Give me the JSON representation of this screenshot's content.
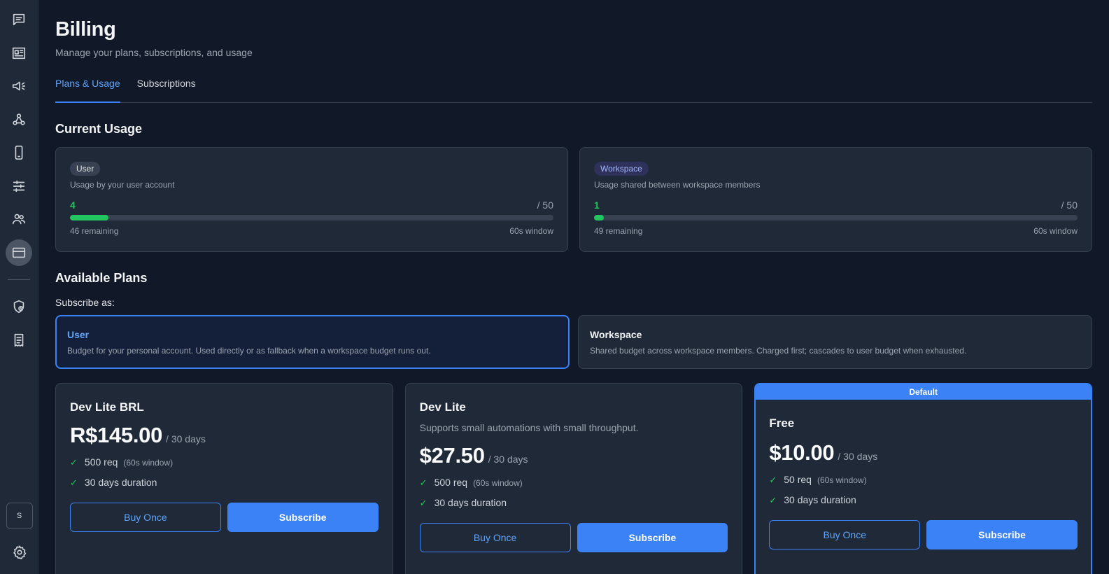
{
  "sidebar": {
    "items": [
      {
        "name": "chat-icon"
      },
      {
        "name": "dashboard-icon"
      },
      {
        "name": "megaphone-icon"
      },
      {
        "name": "webhook-icon"
      },
      {
        "name": "mobile-icon"
      },
      {
        "name": "sliders-icon"
      },
      {
        "name": "users-icon"
      },
      {
        "name": "credit-card-icon",
        "active": true
      },
      {
        "name": "shield-clock-icon"
      },
      {
        "name": "receipt-icon"
      }
    ],
    "avatar_initial": "S"
  },
  "header": {
    "title": "Billing",
    "subtitle": "Manage your plans, subscriptions, and usage"
  },
  "tabs": [
    {
      "label": "Plans & Usage",
      "active": true
    },
    {
      "label": "Subscriptions",
      "active": false
    }
  ],
  "current_usage": {
    "title": "Current Usage",
    "cards": [
      {
        "badge": "User",
        "description": "Usage by your user account",
        "used": "4",
        "limit": "/ 50",
        "fraction": 0.08,
        "remaining": "46 remaining",
        "window": "60s window"
      },
      {
        "badge": "Workspace",
        "description": "Usage shared between workspace members",
        "used": "1",
        "limit": "/ 50",
        "fraction": 0.02,
        "remaining": "49 remaining",
        "window": "60s window"
      }
    ]
  },
  "available_plans": {
    "title": "Available Plans",
    "subscribe_as_label": "Subscribe as:",
    "scopes": [
      {
        "title": "User",
        "description": "Budget for your personal account. Used directly or as fallback when a workspace budget runs out.",
        "selected": true
      },
      {
        "title": "Workspace",
        "description": "Shared budget across workspace members. Charged first; cascades to user budget when exhausted.",
        "selected": false
      }
    ],
    "plans": [
      {
        "name": "Dev Lite BRL",
        "description": "",
        "price": "R$145.00",
        "period": "/ 30 days",
        "features": [
          {
            "check": "✓",
            "text": "500 req",
            "note": "(60s window)"
          },
          {
            "check": "✓",
            "text": "30 days duration",
            "note": ""
          }
        ],
        "buy_label": "Buy Once",
        "subscribe_label": "Subscribe"
      },
      {
        "name": "Dev Lite",
        "description": "Supports small automations with small throughput.",
        "price": "$27.50",
        "period": "/ 30 days",
        "features": [
          {
            "check": "✓",
            "text": "500 req",
            "note": "(60s window)"
          },
          {
            "check": "✓",
            "text": "30 days duration",
            "note": ""
          }
        ],
        "buy_label": "Buy Once",
        "subscribe_label": "Subscribe"
      },
      {
        "banner": "Default",
        "name": "Free",
        "description": "",
        "price": "$10.00",
        "period": "/ 30 days",
        "features": [
          {
            "check": "✓",
            "text": "50 req",
            "note": "(60s window)"
          },
          {
            "check": "✓",
            "text": "30 days duration",
            "note": ""
          }
        ],
        "buy_label": "Buy Once",
        "subscribe_label": "Subscribe"
      }
    ]
  },
  "colors": {
    "accent": "#3b82f6",
    "success": "#22c55e",
    "background": "#111827",
    "card": "#1f2937"
  }
}
